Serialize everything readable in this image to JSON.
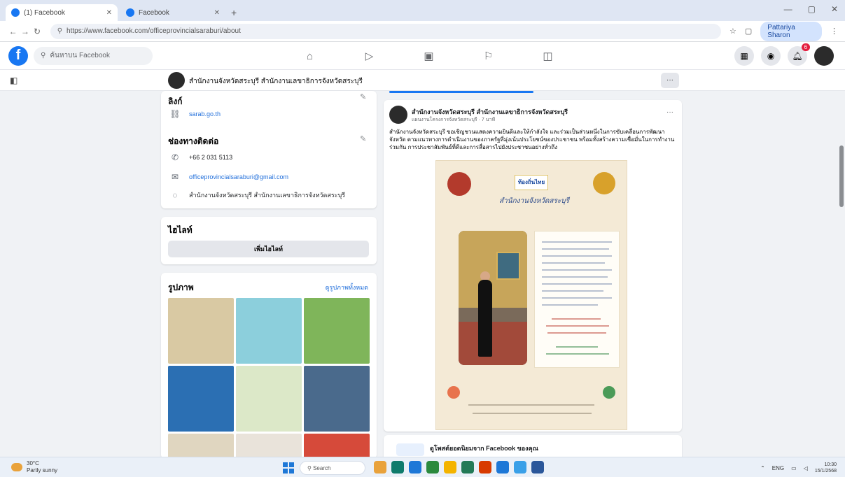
{
  "browser": {
    "tabs": [
      {
        "title": "(1) Facebook",
        "active": true
      },
      {
        "title": "Facebook",
        "active": false
      }
    ],
    "new_tab_label": "+",
    "url": "https://www.facebook.com/officeprovincialsaraburi/about",
    "profile_label": "Pattariya Sharon",
    "window_controls": [
      "—",
      "▢",
      "✕"
    ]
  },
  "facebook_nav": {
    "logo": "f",
    "search_placeholder": "ค้นหาบน Facebook",
    "center_icons": [
      "home-icon",
      "video-icon",
      "marketplace-icon",
      "groups-icon",
      "gaming-icon"
    ],
    "notification_count": "6"
  },
  "page_header": {
    "page_name": "สำนักงานจังหวัดสระบุรี สำนักงานเลขาธิการจังหวัดสระบุรี",
    "more_label": "···"
  },
  "contact_card": {
    "links_heading": "ลิงก์",
    "website": "sarab.go.th",
    "contact_heading": "ช่องทางติดต่อ",
    "phone": "+66 2 031 5113",
    "email": "officeprovincialsaraburi@gmail.com",
    "messenger": "สำนักงานจังหวัดสระบุรี สำนักงานเลขาธิการจังหวัดสระบุรี"
  },
  "featured_card": {
    "heading": "ไฮไลท์",
    "button_label": "เพิ่มไฮไลท์"
  },
  "photos_card": {
    "heading": "รูปภาพ",
    "see_all": "ดูรูปภาพทั้งหมด",
    "photo_colors": [
      "#d9c9a3",
      "#8ccfdc",
      "#7fb55a",
      "#2b6fb3",
      "#dce8c8",
      "#4a6a8c",
      "#e0d6c0",
      "#e9e3da",
      "#d64a3a"
    ]
  },
  "post": {
    "author": "สำนักงานจังหวัดสระบุรี สำนักงานเลขาธิการจังหวัดสระบุรี",
    "meta": "แผนงานโครงการจังหวัดสระบุรี · 7 นาที",
    "text": "สำนักงานจังหวัดสระบุรี ขอเชิญชวนแสดงความยินดีและให้กำลังใจ และร่วมเป็นส่วนหนึ่งในการขับเคลื่อนการพัฒนาจังหวัด ตามแนวทางการดำเนินงานของภาครัฐที่มุ่งเน้นประโยชน์ของประชาชน พร้อมทั้งสร้างความเชื่อมั่นในการทำงานร่วมกัน การประชาสัมพันธ์ที่ดีและการสื่อสารไปยังประชาชนอย่างทั่วถึง",
    "more_label": "···",
    "poster": {
      "logo_text": "ท้องถิ่นไทย",
      "title": "สำนักงานจังหวัดสระบุรี"
    }
  },
  "suggest": {
    "text": "ดูโพสต์ยอดนิยมจาก Facebook ของคุณ"
  },
  "taskbar": {
    "weather_temp": "30°C",
    "weather_text": "Partly sunny",
    "search_label": "Search",
    "app_colors": [
      "#e9a23b",
      "#0f7b6c",
      "#1e78d7",
      "#2b8a3e",
      "#f4b400",
      "#237a57",
      "#d83b01",
      "#1e78d7",
      "#3aa0e8",
      "#2b579a"
    ],
    "tray_lang": "ENG",
    "time": "10:30",
    "date": "15/1/2568"
  }
}
